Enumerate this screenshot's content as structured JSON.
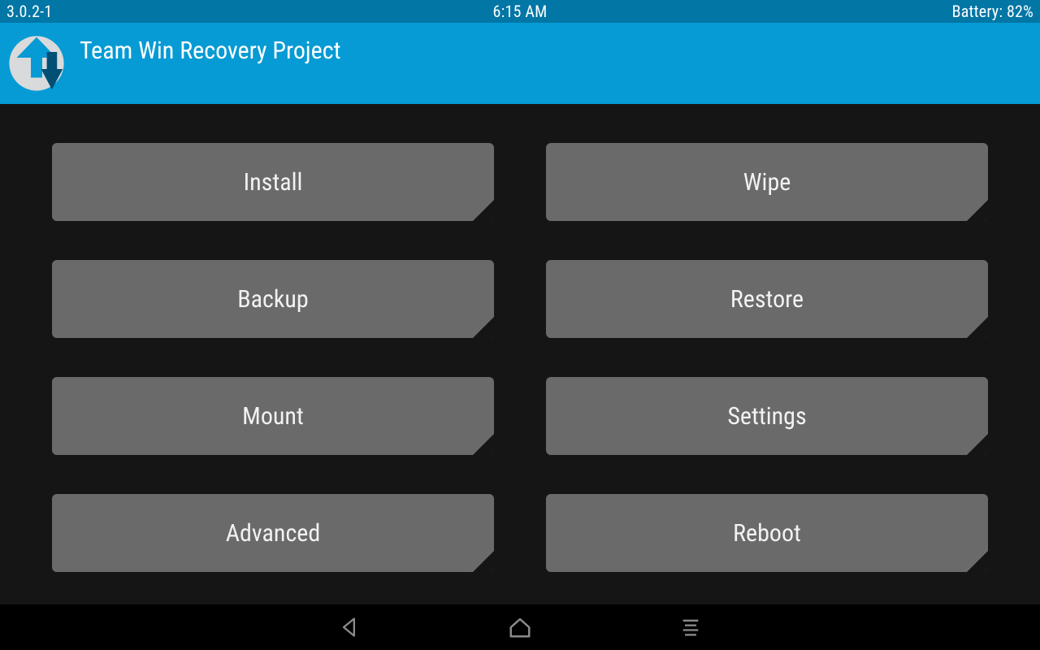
{
  "status": {
    "version": "3.0.2-1",
    "time": "6:15 AM",
    "battery": "Battery: 82%"
  },
  "header": {
    "title": "Team Win Recovery Project"
  },
  "menu": {
    "install": "Install",
    "wipe": "Wipe",
    "backup": "Backup",
    "restore": "Restore",
    "mount": "Mount",
    "settings": "Settings",
    "advanced": "Advanced",
    "reboot": "Reboot"
  },
  "nav": {
    "back": "back-icon",
    "home": "home-icon",
    "log": "log-icon"
  },
  "colors": {
    "status_bg": "#0276a5",
    "header_bg": "#069bd4",
    "body_bg": "#151515",
    "tile_bg": "#6a6a6a"
  }
}
